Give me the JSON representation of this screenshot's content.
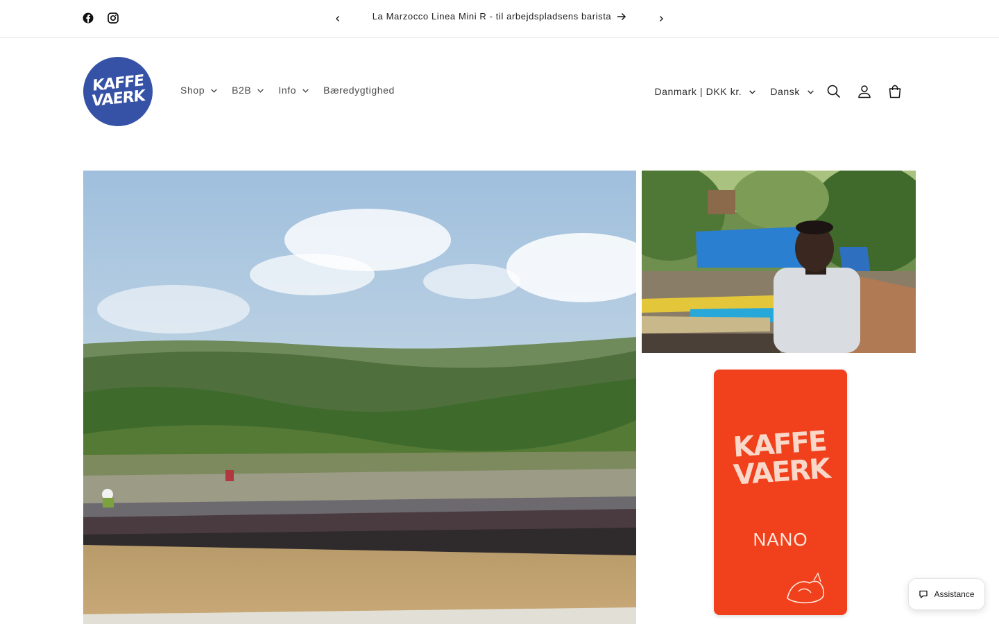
{
  "announcement": {
    "text": "La Marzocco Linea Mini R - til arbejdspladsens barista",
    "social": [
      "facebook-icon",
      "instagram-icon"
    ]
  },
  "logo": {
    "line1": "KAFFE",
    "line2": "VAERK"
  },
  "nav": {
    "items": [
      {
        "label": "Shop",
        "dropdown": true
      },
      {
        "label": "B2B",
        "dropdown": true
      },
      {
        "label": "Info",
        "dropdown": true
      },
      {
        "label": "Bæredygtighed",
        "dropdown": false
      }
    ]
  },
  "header": {
    "country_select": "Danmark | DKK kr.",
    "language_select": "Dansk",
    "icons": [
      "search-icon",
      "account-icon",
      "cart-icon"
    ]
  },
  "gallery": {
    "bag_brand_line1": "KAFFE",
    "bag_brand_line2": "VAERK",
    "bag_name": "NANO"
  },
  "assistance": {
    "label": "Assistance"
  },
  "colors": {
    "brand_blue": "#3652a6",
    "bag_orange": "#f0401c"
  }
}
